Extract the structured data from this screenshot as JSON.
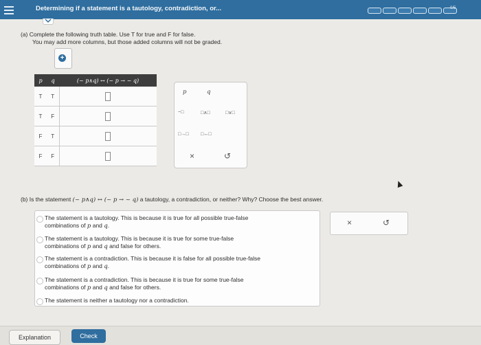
{
  "header": {
    "title": "Determining if a statement is a tautology, contradiction, or...",
    "progress_label": "0/5"
  },
  "part_a": {
    "instruction_line1": "(a) Complete the following truth table. Use T for true and F for false.",
    "instruction_line2": "You may add more columns, but those added columns will not be graded.",
    "table": {
      "headers": [
        "p",
        "q",
        "(~ p∧q) ↔ (~ p → ~ q)"
      ],
      "rows": [
        [
          "T",
          "T"
        ],
        [
          "T",
          "F"
        ],
        [
          "F",
          "T"
        ],
        [
          "F",
          "F"
        ]
      ]
    },
    "palette": {
      "vars": [
        "p",
        "q"
      ],
      "ops": [
        "~□",
        "□∧□",
        "□∨□",
        "□→□",
        "□↔□"
      ],
      "clear_symbol": "×",
      "undo_symbol": "↺"
    }
  },
  "part_b": {
    "question_prefix": "(b) Is the statement",
    "question_math": "(~ p∧q) ↔ (~ p → ~ q)",
    "question_suffix": "a tautology, a contradiction, or neither? Why? Choose the best answer.",
    "options": [
      {
        "line1": "The statement is a tautology. This is because it is true for all possible true-false",
        "line2_pre": "combinations of ",
        "v1": "p",
        "mid": " and ",
        "v2": "q",
        "line2_post": "."
      },
      {
        "line1": "The statement is a tautology. This is because it is true for some true-false",
        "line2_pre": "combinations of ",
        "v1": "p",
        "mid": " and ",
        "v2": "q",
        "line2_post": " and false for others."
      },
      {
        "line1": "The statement is a contradiction. This is because it is false for all possible true-false",
        "line2_pre": "combinations of ",
        "v1": "p",
        "mid": " and ",
        "v2": "q",
        "line2_post": "."
      },
      {
        "line1": "The statement is a contradiction. This is because it is true for some true-false",
        "line2_pre": "combinations of ",
        "v1": "p",
        "mid": " and ",
        "v2": "q",
        "line2_post": " and false for others."
      },
      {
        "line1": "The statement is neither a tautology nor a contradiction."
      }
    ],
    "clear_symbol": "×",
    "undo_symbol": "↺"
  },
  "footer": {
    "explanation_label": "Explanation",
    "check_label": "Check"
  },
  "colors": {
    "header_bg": "#2f6e9f",
    "table_header_bg": "#3d3d3d",
    "check_bg": "#2f6e9f"
  }
}
